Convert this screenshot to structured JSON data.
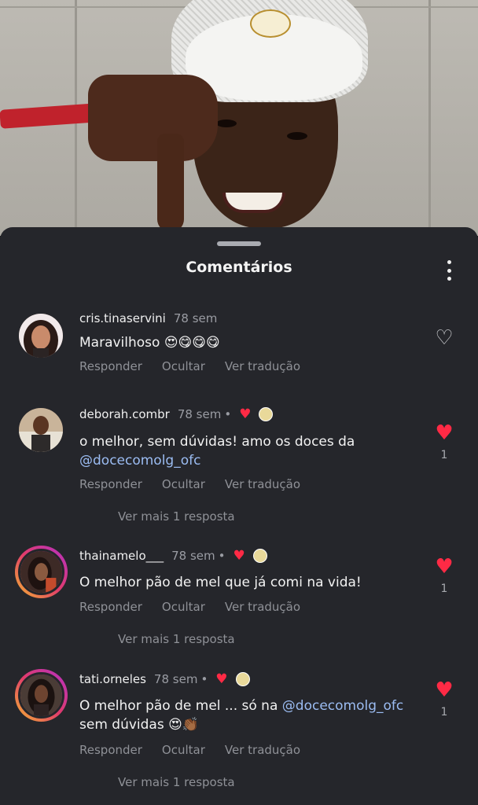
{
  "sheet": {
    "title": "Comentários"
  },
  "comments": [
    {
      "username": "cris.tinaservini",
      "time": "78 sem",
      "text": "Maravilhoso 😍😋😋😋",
      "mention": "",
      "text_after": "",
      "actions": [
        "Responder",
        "Ocultar",
        "Ver tradução"
      ],
      "likes": "",
      "liked": false,
      "replies": ""
    },
    {
      "username": "deborah.combr",
      "time": "78 sem",
      "text": "o melhor, sem dúvidas! amo os doces da",
      "mention": "@docecomolg_ofc",
      "text_after": "",
      "actions": [
        "Responder",
        "Ocultar",
        "Ver tradução"
      ],
      "likes": "1",
      "liked": true,
      "replies": "Ver mais 1 resposta"
    },
    {
      "username": "thainamelo___",
      "time": "78 sem",
      "text": "O melhor pão de mel que já comi na vida!",
      "mention": "",
      "text_after": "",
      "actions": [
        "Responder",
        "Ocultar",
        "Ver tradução"
      ],
      "likes": "1",
      "liked": true,
      "replies": "Ver mais 1 resposta"
    },
    {
      "username": "tati.orneles",
      "time": "78 sem",
      "text": "O melhor pão de mel ... só na",
      "mention": "@docecomolg_ofc",
      "text_after": "sem dúvidas 😍👏🏾",
      "actions": [
        "Responder",
        "Ocultar",
        "Ver tradução"
      ],
      "likes": "1",
      "liked": true,
      "replies": "Ver mais 1 resposta"
    }
  ],
  "colors": {
    "sheet_bg": "#25262b",
    "like_red": "#ff2a45",
    "mention_blue": "#9bbcf2"
  }
}
